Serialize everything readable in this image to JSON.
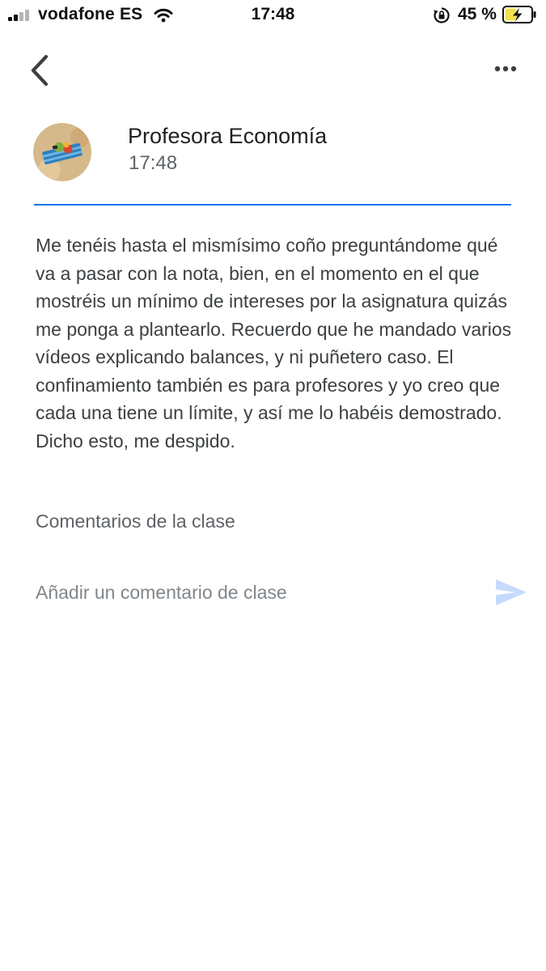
{
  "status_bar": {
    "carrier": "vodafone ES",
    "time": "17:48",
    "battery_percent": "45 %",
    "signal_bars_filled": 2,
    "signal_bars_total": 4,
    "icons": [
      "signal-icon",
      "wifi-icon",
      "rotation-lock-icon",
      "battery-charging-icon"
    ],
    "battery_fill_color": "#f4e04d"
  },
  "app_bar": {
    "icons": [
      "back-arrow-icon",
      "more-options-icon"
    ]
  },
  "post": {
    "author": "Profesora Economía",
    "time": "17:48",
    "accent_color": "#1a73e8",
    "body": "Me tenéis hasta el mismísimo coño preguntándome qué va a pasar con la nota, bien, en el momento en el que mostréis un mínimo de intereses por la asignatura quizás me ponga a plantearlo. Recuerdo que he mandado varios vídeos explicando balances, y ni puñetero caso. El confinamiento también es para profesores y yo creo que cada una tiene un límite, y así me lo habéis demostrado. Dicho esto, me despido."
  },
  "comments": {
    "heading": "Comentarios de la clase",
    "input_placeholder": "Añadir un comentario de clase",
    "input_value": "",
    "send_icon": "send-icon",
    "send_color": "#c6dafc"
  }
}
